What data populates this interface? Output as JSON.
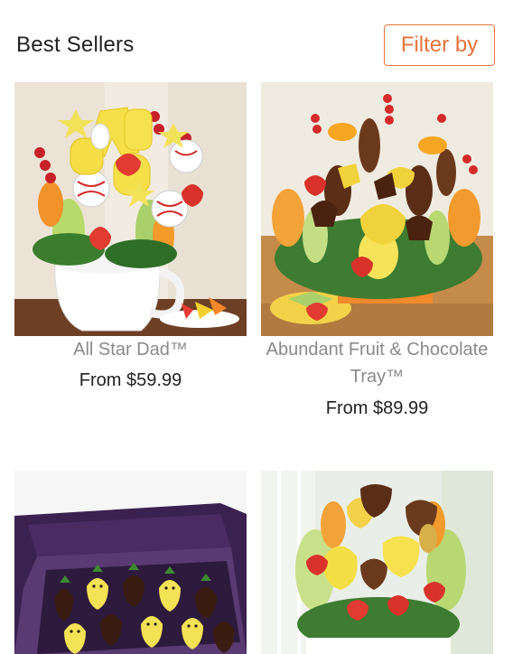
{
  "header": {
    "title": "Best Sellers",
    "filter_label": "Filter by"
  },
  "products": [
    {
      "name": "All Star Dad™",
      "price": "From $59.99"
    },
    {
      "name": "Abundant Fruit & Chocolate Tray™",
      "price": "From $89.99"
    },
    {
      "name": "",
      "price": ""
    },
    {
      "name": "",
      "price": ""
    }
  ],
  "colors": {
    "accent": "#e8733a",
    "title_text": "#222222",
    "product_name": "#8a8a8a"
  }
}
